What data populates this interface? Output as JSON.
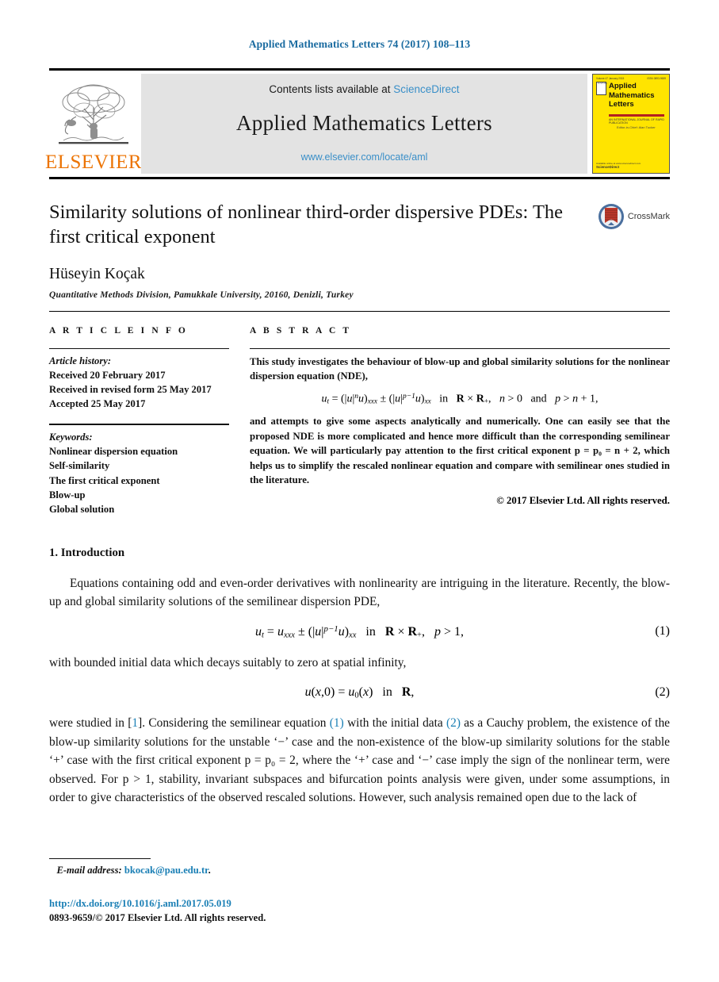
{
  "running_head": "Applied Mathematics Letters 74 (2017) 108–113",
  "masthead": {
    "publisher_wordmark": "ELSEVIER",
    "contents_prefix": "Contents lists available at",
    "sciencedirect_link": "ScienceDirect",
    "journal_name": "Applied Mathematics Letters",
    "journal_url": "www.elsevier.com/locate/aml",
    "cover": {
      "line1": "Applied",
      "line2": "Mathematics",
      "line3": "Letters",
      "top_left": "Volume 47 January 2015",
      "top_right": "ISSN 0893-9659",
      "els_box": "ELSEVIER",
      "subtitle": "AN INTERNATIONAL JOURNAL OF RAPID PUBLICATION",
      "editor": "Editor-in-Chief: Alan Tucker",
      "bottom_small": "Available online at www.sciencedirect.com",
      "bottom_brand": "ScienceDirect"
    },
    "accent_orange": "#ec7404",
    "link_blue": "#3a8fc8",
    "cover_yellow": "#ffe400"
  },
  "article": {
    "title": "Similarity solutions of nonlinear third-order dispersive PDEs: The first critical exponent",
    "crossmark_label": "CrossMark",
    "author": "Hüseyin Koçak",
    "affiliation": "Quantitative Methods Division, Pamukkale University, 20160, Denizli, Turkey"
  },
  "article_info": {
    "heading": "A R T I C L E   I N F O",
    "history_label": "Article history:",
    "history": [
      "Received 20 February 2017",
      "Received in revised form 25 May 2017",
      "Accepted 25 May 2017"
    ],
    "keywords_label": "Keywords:",
    "keywords": [
      "Nonlinear dispersion equation",
      "Self-similarity",
      "The first critical exponent",
      "Blow-up",
      "Global solution"
    ]
  },
  "abstract": {
    "heading": "A B S T R A C T",
    "para1": "This study investigates the behaviour of blow-up and global similarity solutions for the nonlinear dispersion equation (NDE),",
    "equation_plain": "u_t = (|u|^n u)_xxx ± (|u|^{p-1} u)_xx   in   R × R_+,   n > 0   and   p > n + 1,",
    "para2": "and attempts to give some aspects analytically and numerically. One can easily see that the proposed NDE is more complicated and hence more difficult than the corresponding semilinear equation. We will particularly pay attention to the first critical exponent p = p₀ = n + 2, which helps us to simplify the rescaled nonlinear equation and compare with semilinear ones studied in the literature.",
    "copyright": "© 2017 Elsevier Ltd. All rights reserved."
  },
  "body": {
    "section1_title": "1. Introduction",
    "para1": "Equations containing odd and even-order derivatives with nonlinearity are intriguing in the literature. Recently, the blow-up and global similarity solutions of the semilinear dispersion PDE,",
    "eq1_number": "(1)",
    "eq1_plain": "u_t = u_xxx ± (|u|^{p-1} u)_xx   in   R × R_+,   p > 1,",
    "para2": "with bounded initial data which decays suitably to zero at spatial infinity,",
    "eq2_number": "(2)",
    "eq2_plain": "u(x,0) = u_0(x)   in   R,",
    "para3_a": "were studied in [",
    "para3_ref1": "1",
    "para3_b": "]. Considering the semilinear equation ",
    "para3_ref2": "(1)",
    "para3_c": " with the initial data ",
    "para3_ref3": "(2)",
    "para3_d": " as a Cauchy problem, the existence of the blow-up similarity solutions for the unstable ‘−’ case and the non-existence of the blow-up similarity solutions for the stable ‘+’ case with the first critical exponent p = p₀ = 2, where the ‘+’ case and ‘−’ case imply the sign of the nonlinear term, were observed. For p > 1, stability, invariant subspaces and bifurcation points analysis were given, under some assumptions, in order to give characteristics of the observed rescaled solutions. However, such analysis remained open due to the lack of"
  },
  "footer": {
    "email_label": "E-mail address:",
    "email": "bkocak@pau.edu.tr",
    "email_period": ".",
    "doi": "http://dx.doi.org/10.1016/j.aml.2017.05.019",
    "issn_line": "0893-9659/© 2017 Elsevier Ltd. All rights reserved."
  }
}
